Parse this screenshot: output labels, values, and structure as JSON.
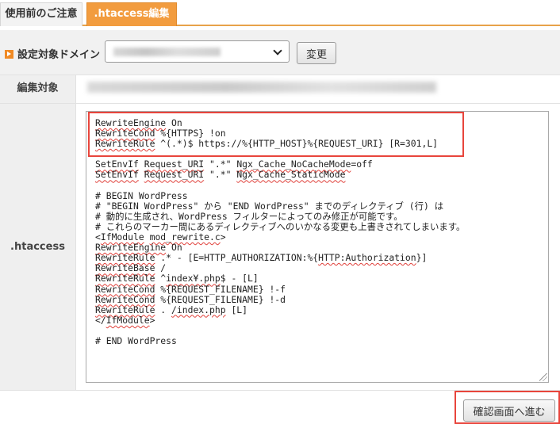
{
  "tabs": [
    {
      "label": "使用前のご注意",
      "active": false
    },
    {
      "label": ".htaccess編集",
      "active": true
    }
  ],
  "domain": {
    "label": "設定対象ドメイン",
    "change_button": "変更"
  },
  "target": {
    "label": "編集対象"
  },
  "htaccess": {
    "label": ".htaccess",
    "lines": [
      "RewriteEngine On",
      "RewriteCond %{HTTPS} !on",
      "RewriteRule ^(.*)$ https://%{HTTP_HOST}%{REQUEST_URI} [R=301,L]",
      "",
      "SetEnvIf Request_URI \".*\" Ngx_Cache_NoCacheMode=off",
      "SetEnvIf Request_URI \".*\" Ngx_Cache_StaticMode",
      "",
      "# BEGIN WordPress",
      "# \"BEGIN WordPress\" から \"END WordPress\" までのディレクティブ (行) は",
      "# 動的に生成され、WordPress フィルターによってのみ修正が可能です。",
      "# これらのマーカー間にあるディレクティブへのいかなる変更も上書きされてしまいます。",
      "<IfModule mod_rewrite.c>",
      "RewriteEngine On",
      "RewriteRule .* - [E=HTTP_AUTHORIZATION:%{HTTP:Authorization}]",
      "RewriteBase /",
      "RewriteRule ^index¥.php$ - [L]",
      "RewriteCond %{REQUEST_FILENAME} !-f",
      "RewriteCond %{REQUEST_FILENAME} !-d",
      "RewriteRule . /index.php [L]",
      "</IfModule>",
      "",
      "# END WordPress"
    ]
  },
  "confirm_button": "確認画面へ進む",
  "colors": {
    "accent": "#f29c3f",
    "highlight": "#e8453c"
  }
}
